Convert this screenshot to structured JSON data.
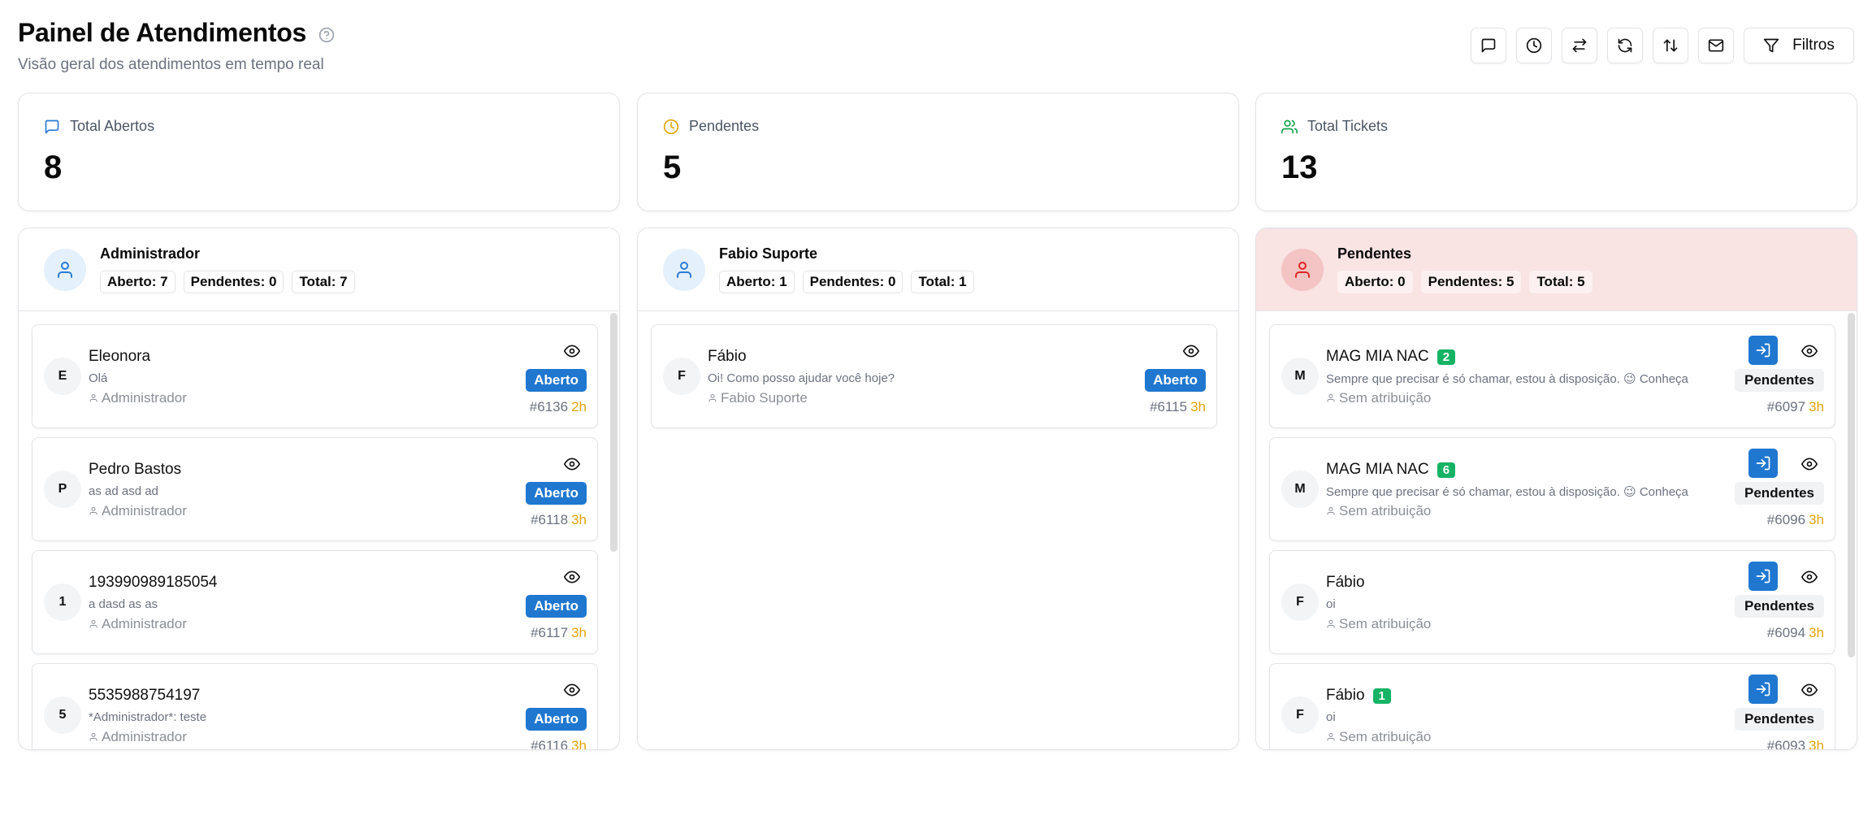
{
  "header": {
    "title": "Painel de Atendimentos",
    "subtitle": "Visão geral dos atendimentos em tempo real",
    "help_icon": "help-circle-icon"
  },
  "toolbar": {
    "buttons": [
      {
        "icon": "message-square-icon"
      },
      {
        "icon": "clock-icon"
      },
      {
        "icon": "arrows-left-right-icon"
      },
      {
        "icon": "refresh-icon"
      },
      {
        "icon": "arrows-up-down-icon"
      },
      {
        "icon": "mail-icon"
      }
    ],
    "filter_label": "Filtros",
    "filter_icon": "funnel-icon"
  },
  "stats": [
    {
      "label": "Total Abertos",
      "value": "8",
      "icon": "message-square-icon",
      "color": "#2b7bd4"
    },
    {
      "label": "Pendentes",
      "value": "5",
      "icon": "clock-icon",
      "color": "#e3a50d"
    },
    {
      "label": "Total Tickets",
      "value": "13",
      "icon": "users-icon",
      "color": "#16a34a"
    }
  ],
  "colors": {
    "primary": "#1f77d0",
    "pending_bg": "#f9e3e3",
    "age": "#e3a50d",
    "badge": "#16b364"
  },
  "columns": [
    {
      "name": "Administrador",
      "chips": [
        "Aberto: 7",
        "Pendentes: 0",
        "Total: 7"
      ],
      "cards": [
        {
          "initial": "E",
          "name": "Eleonora",
          "message": "Olá",
          "owner": "Administrador",
          "status": "Aberto",
          "ticket": "#6136",
          "age": "2h"
        },
        {
          "initial": "P",
          "name": "Pedro Bastos",
          "message": "as ad asd ad",
          "owner": "Administrador",
          "status": "Aberto",
          "ticket": "#6118",
          "age": "3h"
        },
        {
          "initial": "1",
          "name": "193990989185054",
          "message": "a dasd as as",
          "owner": "Administrador",
          "status": "Aberto",
          "ticket": "#6117",
          "age": "3h"
        },
        {
          "initial": "5",
          "name": "5535988754197",
          "message": "*Administrador*: teste",
          "owner": "Administrador",
          "status": "Aberto",
          "ticket": "#6116",
          "age": "3h"
        }
      ]
    },
    {
      "name": "Fabio Suporte",
      "chips": [
        "Aberto: 1",
        "Pendentes: 0",
        "Total: 1"
      ],
      "cards": [
        {
          "initial": "F",
          "name": "Fábio",
          "message": "Oi! Como posso ajudar você hoje?",
          "owner": "Fabio Suporte",
          "status": "Aberto",
          "ticket": "#6115",
          "age": "3h"
        }
      ]
    },
    {
      "name": "Pendentes",
      "chips": [
        "Aberto: 0",
        "Pendentes: 5",
        "Total: 5"
      ],
      "cards": [
        {
          "initial": "M",
          "name": "MAG MIA NAC",
          "badge": "2",
          "message": "Sempre que precisar é só chamar, estou à disposição. 😉 Conheça",
          "owner": "Sem atribuição",
          "status": "Pendentes",
          "ticket": "#6097",
          "age": "3h"
        },
        {
          "initial": "M",
          "name": "MAG MIA NAC",
          "badge": "6",
          "message": "Sempre que precisar é só chamar, estou à disposição. 😉 Conheça",
          "owner": "Sem atribuição",
          "status": "Pendentes",
          "ticket": "#6096",
          "age": "3h"
        },
        {
          "initial": "F",
          "name": "Fábio",
          "message": "oi",
          "owner": "Sem atribuição",
          "status": "Pendentes",
          "ticket": "#6094",
          "age": "3h"
        },
        {
          "initial": "F",
          "name": "Fábio",
          "badge": "1",
          "message": "oi",
          "owner": "Sem atribuição",
          "status": "Pendentes",
          "ticket": "#6093",
          "age": "3h"
        }
      ]
    }
  ]
}
